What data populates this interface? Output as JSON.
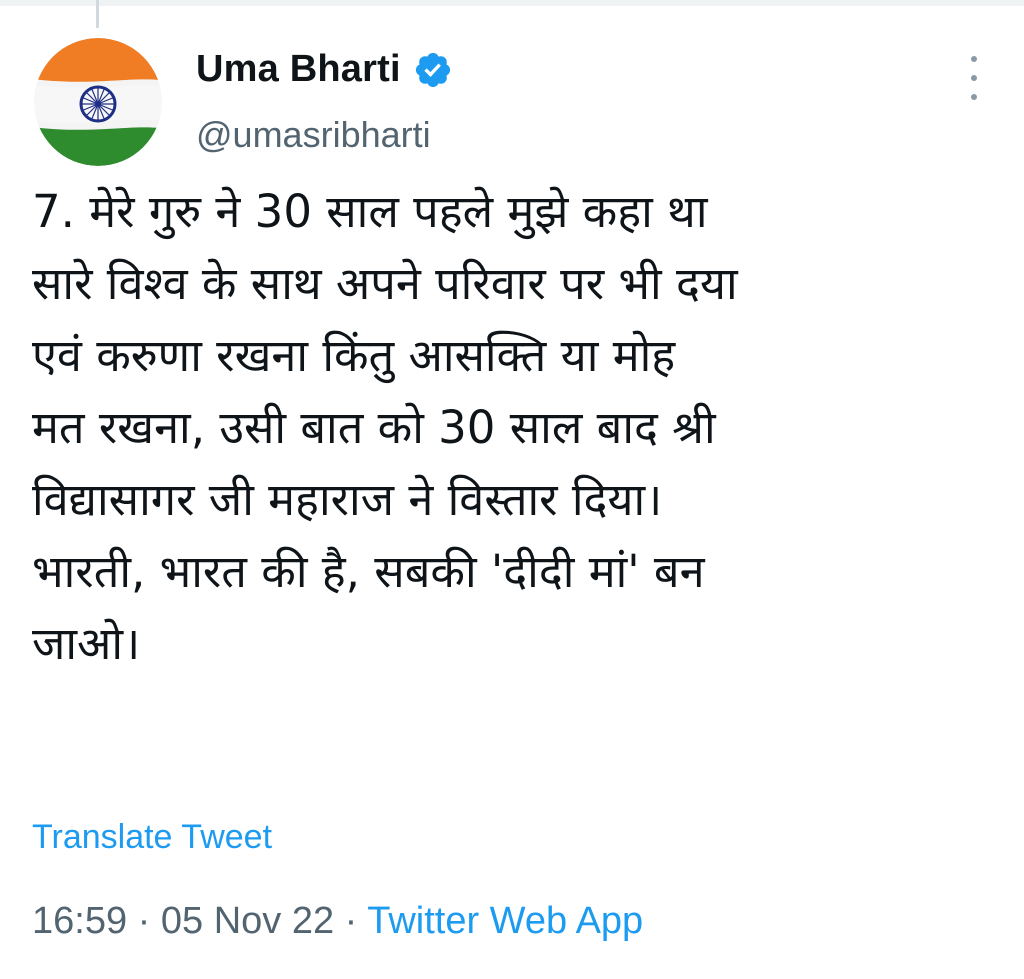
{
  "author": {
    "name": "Uma Bharti",
    "handle": "@umasribharti",
    "verified_icon": "verified-badge-icon",
    "avatar_icon": "indian-flag-avatar"
  },
  "tweet": {
    "text": "7. मेरे गुरु ने 30 साल पहले मुझे कहा था\nसारे विश्व के साथ अपने परिवार पर भी दया\nएवं करुणा रखना किंतु आसक्ति या मोह\nमत रखना, उसी बात को 30 साल बाद श्री\nविद्यासागर जी महाराज ने विस्तार दिया।\nभारती, भारत की है, सबकी 'दीदी मां' बन\nजाओ।",
    "translate_label": "Translate Tweet"
  },
  "meta": {
    "time": "16:59",
    "separator1": " · ",
    "date": "05 Nov 22",
    "separator2": " · ",
    "source": "Twitter Web App"
  },
  "colors": {
    "accent": "#1d9bf0",
    "secondary_text": "#536471",
    "primary_text": "#0f1419"
  }
}
